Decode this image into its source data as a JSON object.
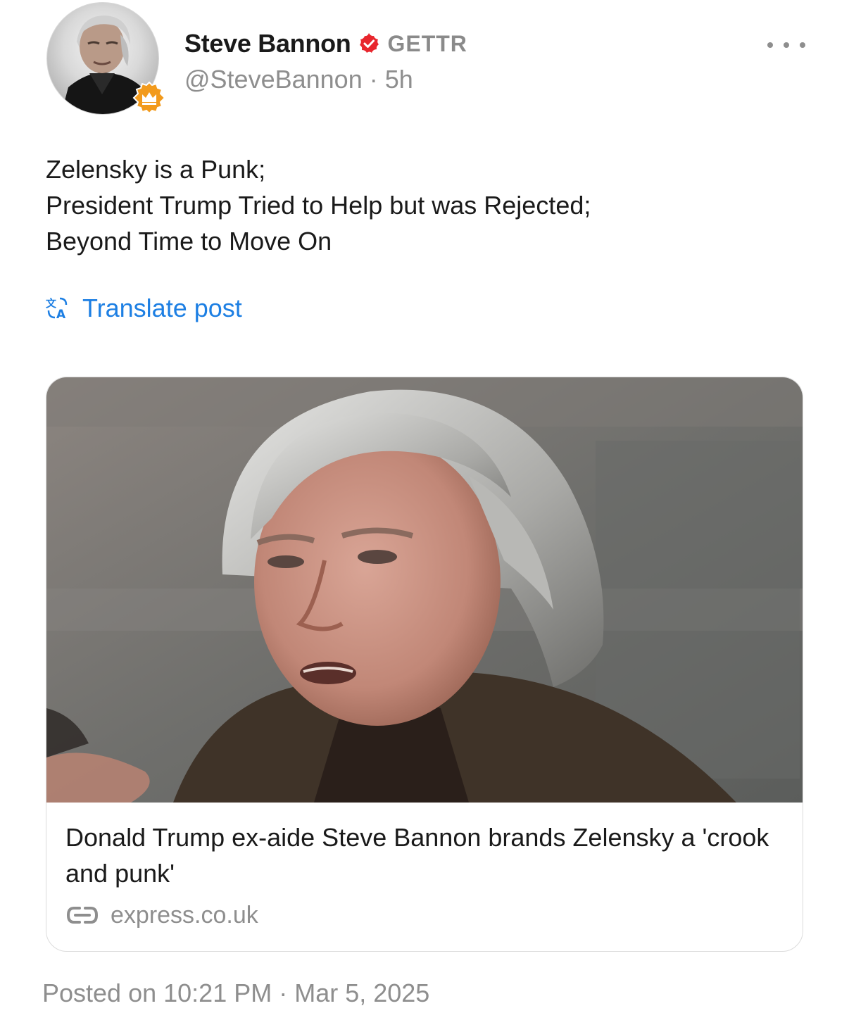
{
  "author": {
    "display_name": "Steve Bannon",
    "platform": "GETTR",
    "handle_line": "@SteveBannon · 5h",
    "verified_icon": "verified-badge-icon",
    "badge_icon": "crown-icon"
  },
  "post": {
    "lines": [
      "Zelensky is a Punk;",
      "President Trump Tried to Help but was Rejected;",
      "Beyond Time to Move On"
    ],
    "translate_label": "Translate post"
  },
  "link_card": {
    "title": "Donald Trump ex-aide Steve Bannon brands Zelensky a 'crook and punk'",
    "domain": "express.co.uk"
  },
  "footer": {
    "posted_line": "Posted on 10:21 PM · Mar 5, 2025"
  },
  "colors": {
    "link_blue": "#1d7fe3",
    "verified_red": "#e8262d",
    "badge_orange": "#f29a1c",
    "muted_gray": "#8e8e8e"
  }
}
